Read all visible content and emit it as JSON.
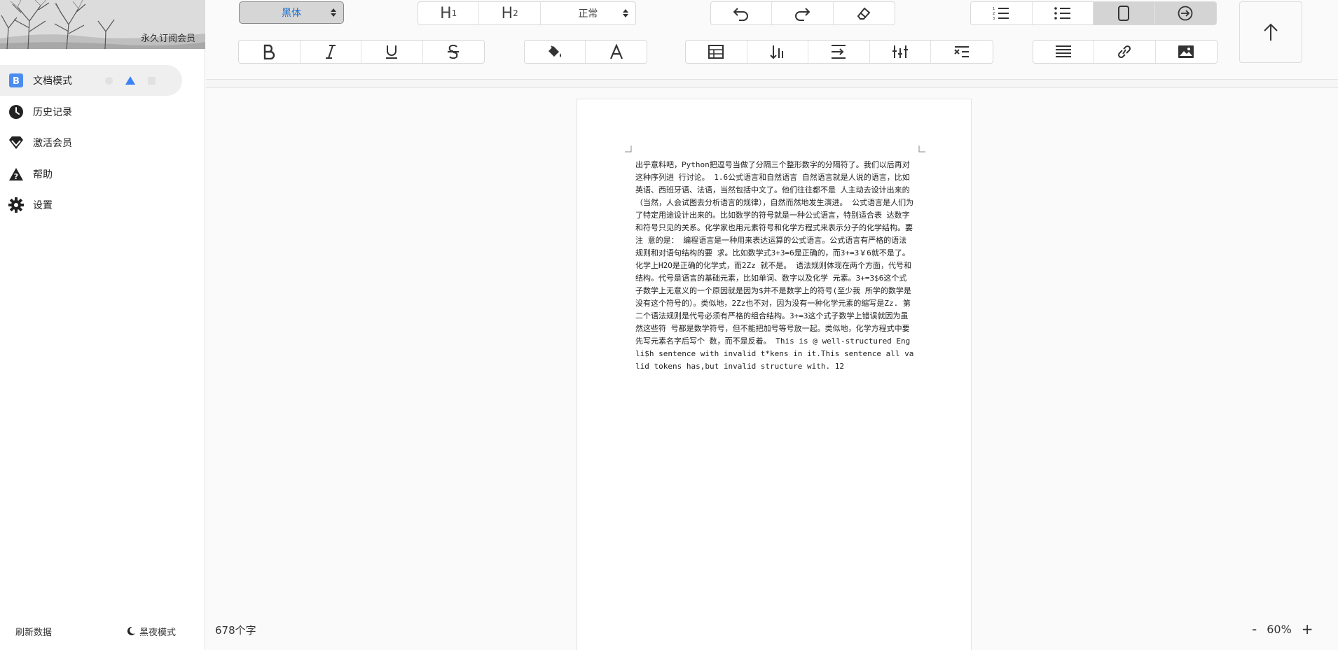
{
  "sidebar": {
    "banner_label": "永久订阅会员",
    "items": [
      {
        "label": "文档模式",
        "icon": "b-badge-icon",
        "active": true
      },
      {
        "label": "历史记录",
        "icon": "clock-icon"
      },
      {
        "label": "激活会员",
        "icon": "diamond-icon"
      },
      {
        "label": "帮助",
        "icon": "help-icon"
      },
      {
        "label": "设置",
        "icon": "gear-icon"
      }
    ],
    "footer": {
      "refresh_label": "刷新数据",
      "night_label": "黑夜模式"
    }
  },
  "toolbar": {
    "font_value": "黑体",
    "h1_label": "H",
    "h1_sub": "1",
    "h2_label": "H",
    "h2_sub": "2",
    "size_value": "正常",
    "accent_color": "#1a6fcf"
  },
  "document": {
    "text": "出乎意料吧，Python把逗号当做了分隔三个整形数字的分隔符了。我们以后再对这种序列进 行讨论。 1.6公式语言和自然语言 自然语言就是人说的语言，比如英语、西班牙语、法语，当然包括中文了。他们往往都不是 人主动去设计出来的（当然，人会试图去分析语言的规律），自然而然地发生演进。 公式语言是人们为了特定用途设计出来的。比如数学的符号就是一种公式语言，特别适合表 达数字和符号只见的关系。化学家也用元素符号和化学方程式来表示分子的化学结构。要注 意的是： 编程语言是一种用来表达运算的公式语言。公式语言有严格的语法规则和对语句结构的要 求。比如数学式3+3=6是正确的，而3+=3￥6就不是了。化学上H2O是正确的化学式，而2Zz 就不是。 语法规则体现在两个方面，代号和结构。代号是语言的基础元素，比如单词、数字以及化学 元素。3+=3$6这个式子数学上无意义的一个原因就是因为$并不是数学上的符号(至少我 所学的数学是没有这个符号的）。类似地，2Zz也不对，因为没有一种化学元素的缩写是Zz. 第二个语法规则是代号必须有严格的组合结构。3+=3这个式子数学上错误就因为虽然这些符 号都是数学符号，但不能把加号等号放一起。类似地，化学方程式中要先写元素名字后写个 数，而不是反着。 This is @ well-structured Engli$h sentence with invalid t*kens in it.This sentence all valid tokens has,but invalid structure with. 12"
  },
  "status": {
    "word_count": "678个字",
    "zoom_minus": "-",
    "zoom_value": "60%",
    "zoom_plus": "+"
  }
}
